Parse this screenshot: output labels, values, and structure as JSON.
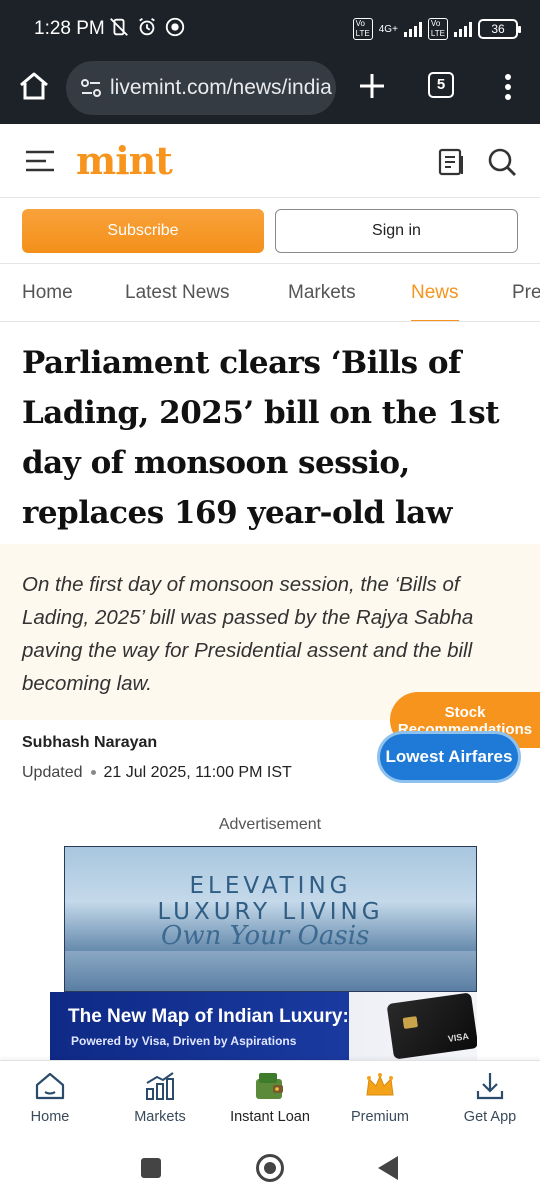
{
  "status_bar": {
    "time": "1:28 PM",
    "network": "4G+",
    "battery": "36"
  },
  "browser": {
    "url": "livemint.com/news/india",
    "tab_count": "5"
  },
  "site": {
    "logo": "mint",
    "brand_color": "#f7941d"
  },
  "actions": {
    "subscribe": "Subscribe",
    "sign_in": "Sign in"
  },
  "nav_tabs": [
    {
      "label": "Home"
    },
    {
      "label": "Latest News"
    },
    {
      "label": "Markets"
    },
    {
      "label": "News"
    },
    {
      "label": "Premium"
    }
  ],
  "active_tab": "News",
  "article": {
    "headline": "Parliament clears ‘Bills of Lading, 2025’ bill on the 1st day of monsoon sessio, replaces 169 year-old law",
    "summary": "On the first day of monsoon session, the ‘Bills of Lading, 2025’ bill was passed by the Rajya Sabha paving the way for Presidential assent and the bill becoming law.",
    "author": "Subhash Narayan",
    "updated_label": "Updated",
    "updated_date": "21 Jul 2025, 11:00 PM IST"
  },
  "floating": {
    "stock_line1": "Stock",
    "stock_line2": "Recommendations",
    "airfares": "Lowest Airfares"
  },
  "ad": {
    "label": "Advertisement",
    "line1": "ELEVATING",
    "line2": "LUXURY LIVING",
    "script": "Own Your Oasis",
    "strip_title": "The New Map of Indian Luxury:",
    "strip_sub": "Powered by Visa, Driven by Aspirations",
    "card_brand": "VISA"
  },
  "bottom_nav": {
    "home": "Home",
    "markets": "Markets",
    "instant_loan": "Instant Loan",
    "premium": "Premium",
    "get_app": "Get App"
  }
}
